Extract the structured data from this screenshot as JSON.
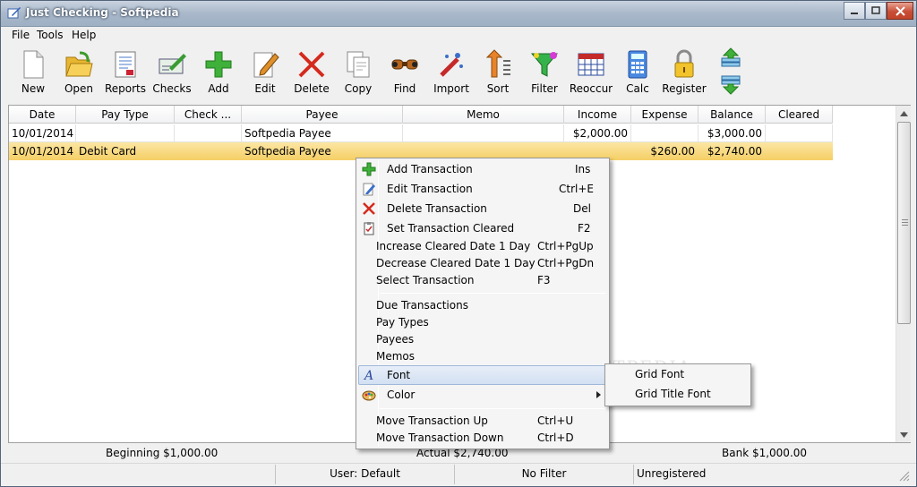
{
  "window": {
    "title": "Just Checking - Softpedia"
  },
  "menubar": {
    "items": [
      "File",
      "Tools",
      "Help"
    ]
  },
  "toolbar": {
    "buttons": [
      "New",
      "Open",
      "Reports",
      "Checks",
      "Add",
      "Edit",
      "Delete",
      "Copy",
      "Find",
      "Import",
      "Sort",
      "Filter",
      "Reoccur",
      "Calc",
      "Register"
    ]
  },
  "grid": {
    "columns": [
      "Date",
      "Pay Type",
      "Check ...",
      "Payee",
      "Memo",
      "Income",
      "Expense",
      "Balance",
      "Cleared"
    ],
    "rows": [
      [
        "10/01/2014",
        "",
        "",
        "Softpedia Payee",
        "",
        "$2,000.00",
        "",
        "$3,000.00",
        ""
      ],
      [
        "10/01/2014",
        "Debit Card",
        "",
        "Softpedia Payee",
        "",
        "",
        "$260.00",
        "$2,740.00",
        ""
      ]
    ]
  },
  "context_menu": {
    "add": {
      "label": "Add Transaction",
      "shortcut": "Ins"
    },
    "edit": {
      "label": "Edit Transaction",
      "shortcut": "Ctrl+E"
    },
    "delete": {
      "label": "Delete Transaction",
      "shortcut": "Del"
    },
    "set_cleared": {
      "label": "Set Transaction Cleared",
      "shortcut": "F2"
    },
    "inc_cleared": {
      "label": "Increase Cleared Date 1 Day",
      "shortcut": "Ctrl+PgUp"
    },
    "dec_cleared": {
      "label": "Decrease Cleared Date 1 Day",
      "shortcut": "Ctrl+PgDn"
    },
    "select": {
      "label": "Select Transaction",
      "shortcut": "F3"
    },
    "due": {
      "label": "Due Transactions"
    },
    "pay_types": {
      "label": "Pay Types"
    },
    "payees": {
      "label": "Payees"
    },
    "memos": {
      "label": "Memos"
    },
    "font": {
      "label": "Font"
    },
    "color": {
      "label": "Color"
    },
    "move_up": {
      "label": "Move Transaction Up",
      "shortcut": "Ctrl+U"
    },
    "move_down": {
      "label": "Move Transaction Down",
      "shortcut": "Ctrl+D"
    }
  },
  "font_submenu": {
    "grid_font": "Grid Font",
    "grid_title_font": "Grid Title Font"
  },
  "summary": {
    "beginning": "Beginning $1,000.00",
    "actual": "Actual $2,740.00",
    "bank": "Bank $1,000.00"
  },
  "status": {
    "user": "User: Default",
    "filter": "No Filter",
    "registration": "Unregistered"
  },
  "watermark": "SOFTPEDIA",
  "colors": {
    "selected_row": "#f5cf65",
    "menu_highlight": "#d3e0f2"
  }
}
